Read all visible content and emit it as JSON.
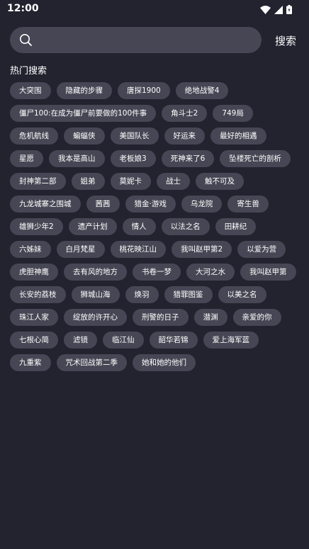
{
  "status_bar": {
    "time": "12:00",
    "icons": [
      "wifi-icon",
      "cellular-signal-icon",
      "battery-icon"
    ]
  },
  "search": {
    "placeholder": "",
    "value": "",
    "button_label": "搜索"
  },
  "hot_search": {
    "title": "热门搜索",
    "tags": [
      "大突围",
      "隐藏的步骤",
      "唐探1900",
      "绝地战警4",
      "僵尸100:在成为僵尸前要做的100件事",
      "角斗士2",
      "749局",
      "危机航线",
      "蝙蝠侠",
      "美国队长",
      "好运来",
      "最好的相遇",
      "星愿",
      "我本是高山",
      "老板娘3",
      "死神来了6",
      "坠楼死亡的剖析",
      "封神第二部",
      "姐弟",
      "莫妮卡",
      "战士",
      "触不可及",
      "九龙城寨之围城",
      "茜茜",
      "猎金·游戏",
      "乌龙院",
      "寄生兽",
      "雄狮少年2",
      "遗产计划",
      "情人",
      "以法之名",
      "田耕纪",
      "六姊妹",
      "白月梵星",
      "桃花映江山",
      "我叫赵甲第2",
      "以爱为营",
      "虎胆神鹰",
      "去有风的地方",
      "书卷一梦",
      "大河之水",
      "我叫赵甲第",
      "长安的荔枝",
      "狮城山海",
      "焕羽",
      "猎罪图鉴",
      "以美之名",
      "珠江人家",
      "绽放的许开心",
      "刑警的日子",
      "潜渊",
      "亲爱的你",
      "七根心简",
      "滤镜",
      "临江仙",
      "韶华若锦",
      "爱上海军蓝",
      "九重紫",
      "咒术回战第二季",
      "她和她的他们"
    ]
  }
}
